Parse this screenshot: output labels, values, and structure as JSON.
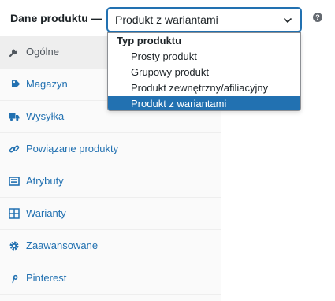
{
  "panel": {
    "title": "Dane produktu —"
  },
  "product_type": {
    "selected": "Produkt z wariantami",
    "group_label": "Typ produktu",
    "options": [
      {
        "label": "Prosty produkt",
        "selected": false
      },
      {
        "label": "Grupowy produkt",
        "selected": false
      },
      {
        "label": "Produkt zewnętrzny/afiliacyjny",
        "selected": false
      },
      {
        "label": "Produkt z wariantami",
        "selected": true
      }
    ]
  },
  "help": {
    "glyph": "?",
    "icon": "help-circle-icon"
  },
  "tabs": [
    {
      "label": "Ogólne",
      "icon": "wrench-icon",
      "active": true
    },
    {
      "label": "Magazyn",
      "icon": "tag-icon",
      "active": false
    },
    {
      "label": "Wysyłka",
      "icon": "truck-icon",
      "active": false
    },
    {
      "label": "Powiązane produkty",
      "icon": "link-icon",
      "active": false
    },
    {
      "label": "Atrybuty",
      "icon": "list-card-icon",
      "active": false
    },
    {
      "label": "Warianty",
      "icon": "grid-icon",
      "active": false
    },
    {
      "label": "Zaawansowane",
      "icon": "gear-icon",
      "active": false
    },
    {
      "label": "Pinterest",
      "icon": "pinterest-icon",
      "active": false
    }
  ],
  "colors": {
    "accent": "#2271b1",
    "text": "#1d2327",
    "icon_gray": "#50575e",
    "active_tab_bg": "#eeeeee",
    "sidebar_bg": "#fafafa"
  }
}
